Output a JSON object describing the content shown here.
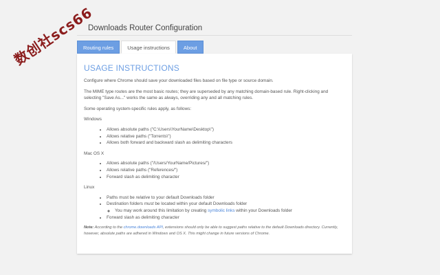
{
  "watermark": "数创社scs66",
  "page": {
    "title": "Downloads Router Configuration"
  },
  "tabs": [
    {
      "label": "Routing rules"
    },
    {
      "label": "Usage instructions"
    },
    {
      "label": "About"
    }
  ],
  "instructions": {
    "heading": "USAGE INSTRUCTIONS",
    "intro": "Configure where Chrome should save your downloaded files based on file type or source domain.",
    "mime_para": "The MIME type routes are the most basic routes; they are superseded by any matching domain-based rule. Right-clicking and selecting \"Save As...\" works the same as always, overriding any and all matching rules.",
    "os_para": "Some operating system-specific rules apply, as follows:",
    "windows": {
      "name": "Windows",
      "items": [
        "Allows absolute paths (\"C:\\Users\\YourName\\Desktop\\\")",
        "Allows relative paths (\"Torrents\\\")",
        "Allows both forward and backward slash as delimiting characters"
      ]
    },
    "mac": {
      "name": "Mac OS X",
      "items": [
        "Allows absolute paths (\"/Users/YourName/Pictures/\")",
        "Allows relative paths (\"References/\")",
        "Forward slash as delimiting character"
      ]
    },
    "linux": {
      "name": "Linux",
      "item1_pre": "Paths must be ",
      "item1_em": "relative",
      "item1_post": " to your default Downloads folder",
      "item2_pre": "Destination folders ",
      "item2_em": "must",
      "item2_post": " be located within your default Downloads folder",
      "sub_pre": "You may work around this limitation by creating ",
      "sub_link": "symbolic links",
      "sub_post": " within your Downloads folder",
      "item3": "Forward slash as delimiting character"
    },
    "note": {
      "label": "Note:",
      "pre": " According to the ",
      "link": "chrome.downloads API",
      "post": ", extensions should only be able to suggest paths relative to the default Downloads directory. Currently, however, absolute paths are adhered in Windows and OS X. This might change in future versions of Chrome."
    }
  }
}
